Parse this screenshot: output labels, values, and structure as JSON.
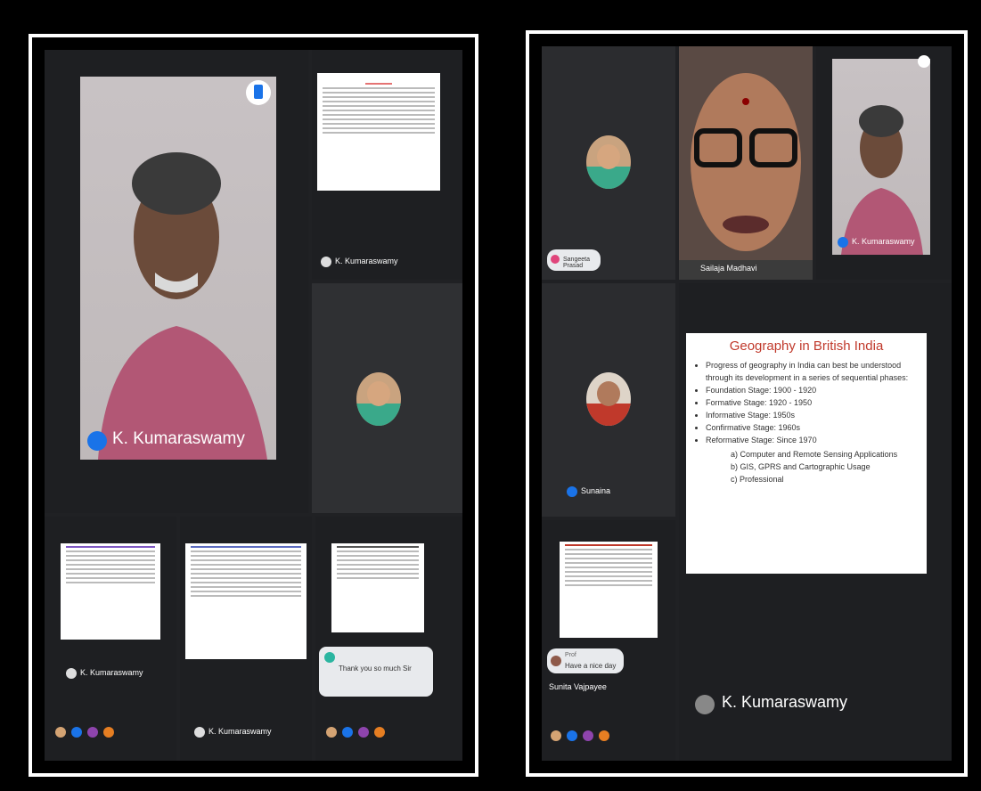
{
  "left": {
    "main_speaker": "K. Kumaraswamy",
    "side_tile_name": "K. Kumaraswamy",
    "bottom_tiles": [
      {
        "name": "K. Kumaraswamy"
      },
      {
        "name": "K. Kumaraswamy"
      },
      {
        "name": "K. Kumaraswamy"
      }
    ],
    "toast": "Thank you so much Sir"
  },
  "right": {
    "top_tile_1_caption": "Sangeeta Prasad",
    "top_tile_2_caption": "Sailaja Madhavi",
    "top_tile_3_caption": "K. Kumaraswamy",
    "avatar_tile_caption": "Sunaina",
    "small_tile_caption": "Sunita Vajpayee",
    "chat_sender": "Prof",
    "chat_text": "Have a nice day",
    "presenter": "K. Kumaraswamy",
    "slide": {
      "title": "Geography in British India",
      "bullets": [
        "Progress of geography in India can best be understood through its development in a series of sequential phases:",
        "Foundation Stage: 1900 - 1920",
        "Formative Stage: 1920 - 1950",
        "Informative Stage: 1950s",
        "Confirmative Stage: 1960s",
        "Reformative Stage: Since 1970"
      ],
      "subitems": [
        "a) Computer and Remote Sensing Applications",
        "b) GIS, GPRS and Cartographic Usage",
        "c) Professional"
      ]
    }
  },
  "colors": {
    "accent": "#1a73e8",
    "slide_title": "#c0392b"
  }
}
